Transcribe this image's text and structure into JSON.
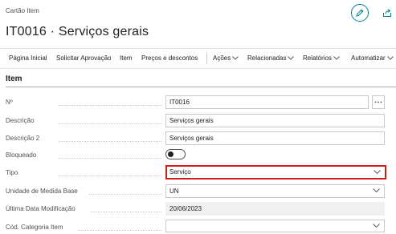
{
  "header": {
    "page_kind": "Cartão Item",
    "title": "IT0016 · Serviços gerais"
  },
  "icons": {
    "edit": "pencil-icon",
    "share": "share-icon",
    "lookup": "ellipsis-icon",
    "dropdown": "chevron-down-icon"
  },
  "colors": {
    "accent": "#008489",
    "highlight": "#d11c1c",
    "readonly_bg": "#f0f0f0"
  },
  "actions": {
    "pagina_inicial": "Página Inicial",
    "solicitar_aprovacao": "Solicitar Aprovação",
    "item": "Item",
    "precos": "Preços e descontos",
    "acoes": "Ações",
    "relacionadas": "Relacionadas",
    "relatorios": "Relatórios",
    "automatizar": "Automatizar"
  },
  "section": {
    "title": "Item"
  },
  "fields": {
    "no": {
      "label": "Nº",
      "value": "IT0016"
    },
    "descricao": {
      "label": "Descrição",
      "value": "Serviços gerais"
    },
    "descricao2": {
      "label": "Descrição 2",
      "value": "Serviços gerais"
    },
    "bloqueado": {
      "label": "Bloqueado",
      "value": "Não"
    },
    "tipo": {
      "label": "Tipo",
      "value": "Serviço"
    },
    "unidade": {
      "label": "Unidade de Medida Base",
      "value": "UN"
    },
    "ultima_data": {
      "label": "Última Data Modificação",
      "value": "20/06/2023"
    },
    "categoria": {
      "label": "Cód. Categoria Item",
      "value": ""
    }
  }
}
